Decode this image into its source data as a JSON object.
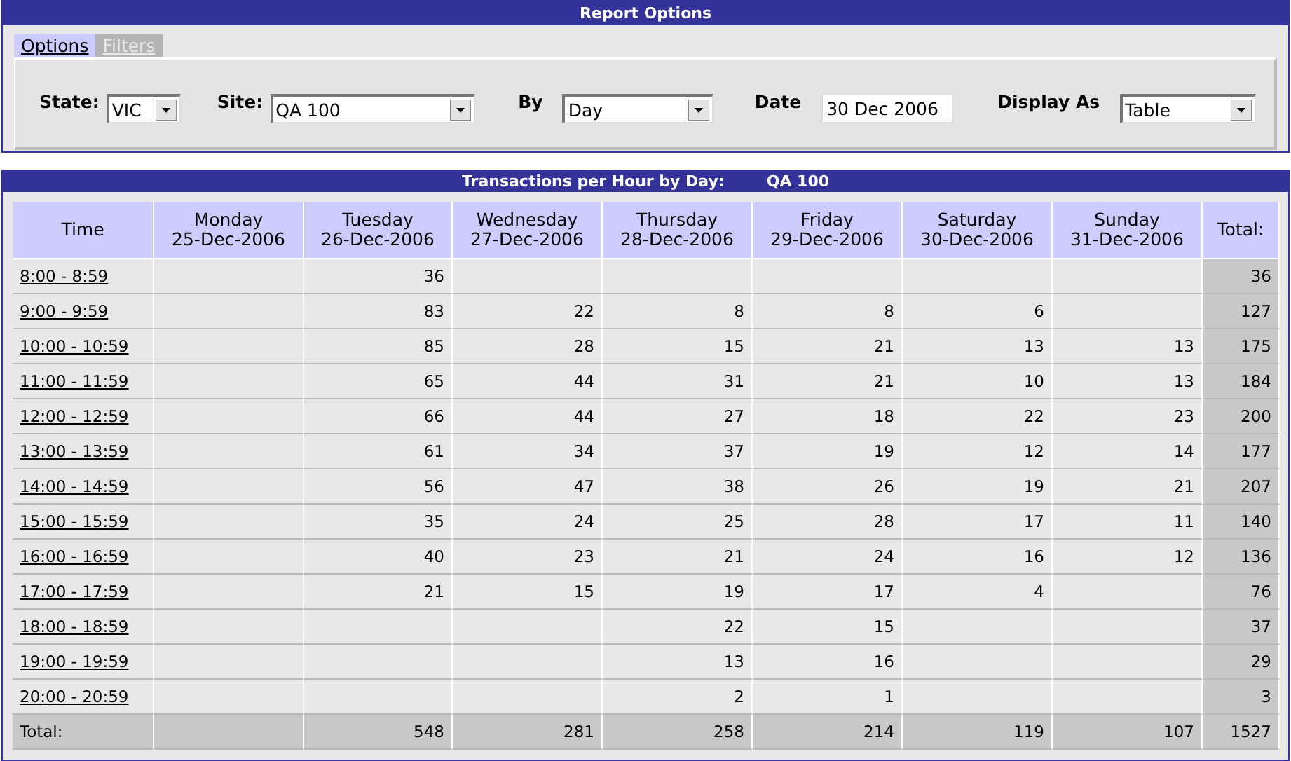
{
  "report_options": {
    "title": "Report Options",
    "tabs": [
      {
        "label": "Options",
        "selected": true
      },
      {
        "label": "Filters",
        "selected": false
      }
    ],
    "fields": [
      {
        "kind": "select",
        "label": "State:",
        "value": "VIC"
      },
      {
        "kind": "select",
        "label": "Site:",
        "value": "QA 100"
      },
      {
        "kind": "select",
        "label": "By",
        "value": "Day"
      },
      {
        "kind": "text",
        "label": "Date",
        "value": "30 Dec 2006"
      },
      {
        "kind": "select",
        "label": "Display As",
        "value": "Table"
      }
    ]
  },
  "report": {
    "title": "Transactions per Hour by Day:",
    "site": "QA 100",
    "table": {
      "columns": [
        {
          "day": "Time"
        },
        {
          "day": "Monday",
          "date": "25-Dec-2006"
        },
        {
          "day": "Tuesday",
          "date": "26-Dec-2006"
        },
        {
          "day": "Wednesday",
          "date": "27-Dec-2006"
        },
        {
          "day": "Thursday",
          "date": "28-Dec-2006"
        },
        {
          "day": "Friday",
          "date": "29-Dec-2006"
        },
        {
          "day": "Saturday",
          "date": "30-Dec-2006"
        },
        {
          "day": "Sunday",
          "date": "31-Dec-2006"
        },
        {
          "day": "Total:"
        }
      ],
      "rows": [
        {
          "kind": "hour",
          "cells": [
            "8:00 - 8:59",
            "",
            "36",
            "",
            "",
            "",
            "",
            "",
            "36"
          ]
        },
        {
          "kind": "hour",
          "cells": [
            "9:00 - 9:59",
            "",
            "83",
            "22",
            "8",
            "8",
            "6",
            "",
            "127"
          ]
        },
        {
          "kind": "hour",
          "cells": [
            "10:00 - 10:59",
            "",
            "85",
            "28",
            "15",
            "21",
            "13",
            "13",
            "175"
          ]
        },
        {
          "kind": "hour",
          "cells": [
            "11:00 - 11:59",
            "",
            "65",
            "44",
            "31",
            "21",
            "10",
            "13",
            "184"
          ]
        },
        {
          "kind": "hour",
          "cells": [
            "12:00 - 12:59",
            "",
            "66",
            "44",
            "27",
            "18",
            "22",
            "23",
            "200"
          ]
        },
        {
          "kind": "hour",
          "cells": [
            "13:00 - 13:59",
            "",
            "61",
            "34",
            "37",
            "19",
            "12",
            "14",
            "177"
          ]
        },
        {
          "kind": "hour",
          "cells": [
            "14:00 - 14:59",
            "",
            "56",
            "47",
            "38",
            "26",
            "19",
            "21",
            "207"
          ]
        },
        {
          "kind": "hour",
          "cells": [
            "15:00 - 15:59",
            "",
            "35",
            "24",
            "25",
            "28",
            "17",
            "11",
            "140"
          ]
        },
        {
          "kind": "hour",
          "cells": [
            "16:00 - 16:59",
            "",
            "40",
            "23",
            "21",
            "24",
            "16",
            "12",
            "136"
          ]
        },
        {
          "kind": "hour",
          "cells": [
            "17:00 - 17:59",
            "",
            "21",
            "15",
            "19",
            "17",
            "4",
            "",
            "76"
          ]
        },
        {
          "kind": "hour",
          "cells": [
            "18:00 - 18:59",
            "",
            "",
            "",
            "22",
            "15",
            "",
            "",
            "37"
          ]
        },
        {
          "kind": "hour",
          "cells": [
            "19:00 - 19:59",
            "",
            "",
            "",
            "13",
            "16",
            "",
            "",
            "29"
          ]
        },
        {
          "kind": "hour",
          "cells": [
            "20:00 - 20:59",
            "",
            "",
            "",
            "2",
            "1",
            "",
            "",
            "3"
          ]
        },
        {
          "kind": "total",
          "cells": [
            "Total:",
            "",
            "548",
            "281",
            "258",
            "214",
            "119",
            "107",
            "1527"
          ]
        }
      ]
    }
  }
}
